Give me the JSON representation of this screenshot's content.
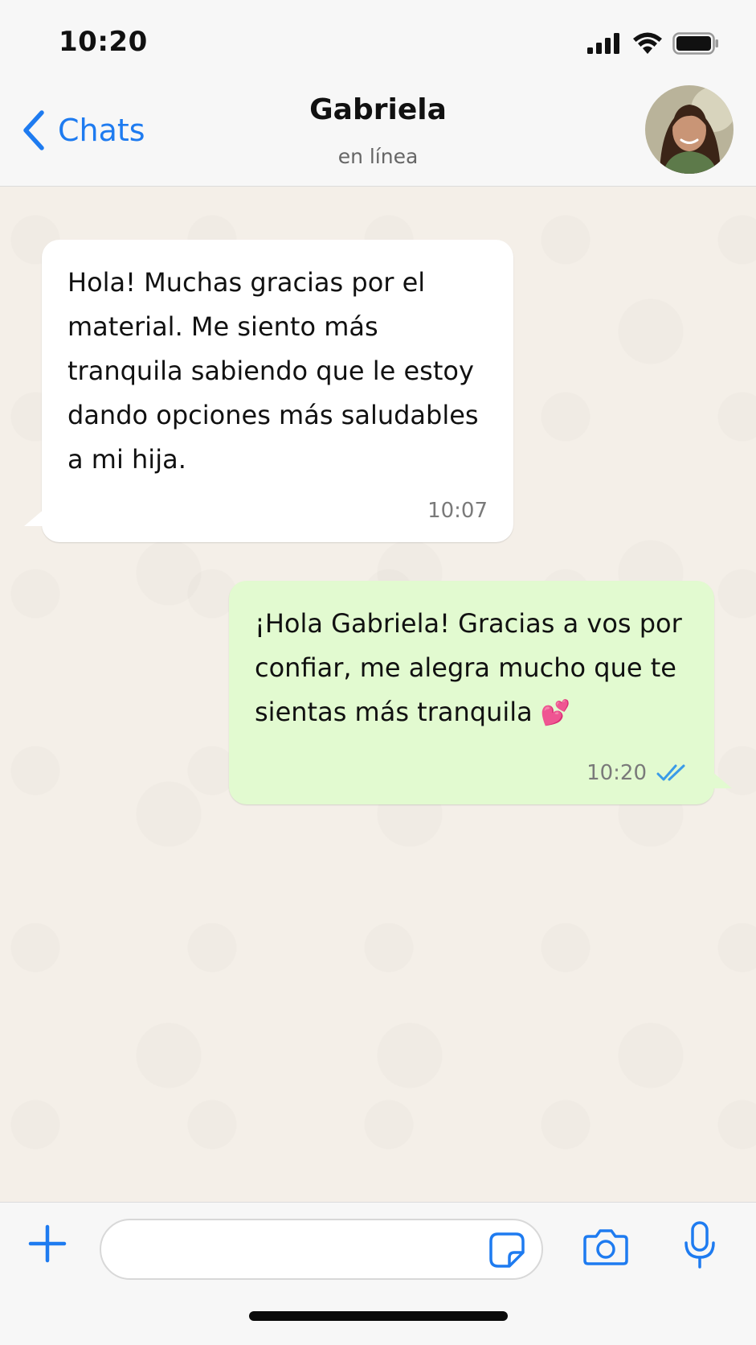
{
  "status_bar": {
    "time": "10:20"
  },
  "header": {
    "back_label": "Chats",
    "contact_name": "Gabriela",
    "contact_status": "en línea"
  },
  "messages": [
    {
      "direction": "incoming",
      "text": "Hola! Muchas gracias por el material. Me siento más tranquila sabiendo que le estoy dando opciones más saludables a mi hija.",
      "time": "10:07"
    },
    {
      "direction": "outgoing",
      "text": "¡Hola Gabriela! Gracias a vos por confiar, me alegra mucho que te sientas más tranquila",
      "emoji": "💕",
      "time": "10:20",
      "status_icon": "double-check-read-icon"
    }
  ],
  "composer": {
    "value": "",
    "placeholder": ""
  },
  "colors": {
    "accent": "#1e7bf0",
    "incoming_bubble": "#ffffff",
    "outgoing_bubble": "#e2fad0",
    "chat_background": "#f4efe8",
    "read_ticks": "#3a9be8"
  },
  "icons": {
    "back": "chevron-left-icon",
    "add": "plus-icon",
    "sticker": "sticker-icon",
    "camera": "camera-icon",
    "mic": "microphone-icon",
    "signal": "cellular-signal-icon",
    "wifi": "wifi-icon",
    "battery": "battery-icon"
  }
}
